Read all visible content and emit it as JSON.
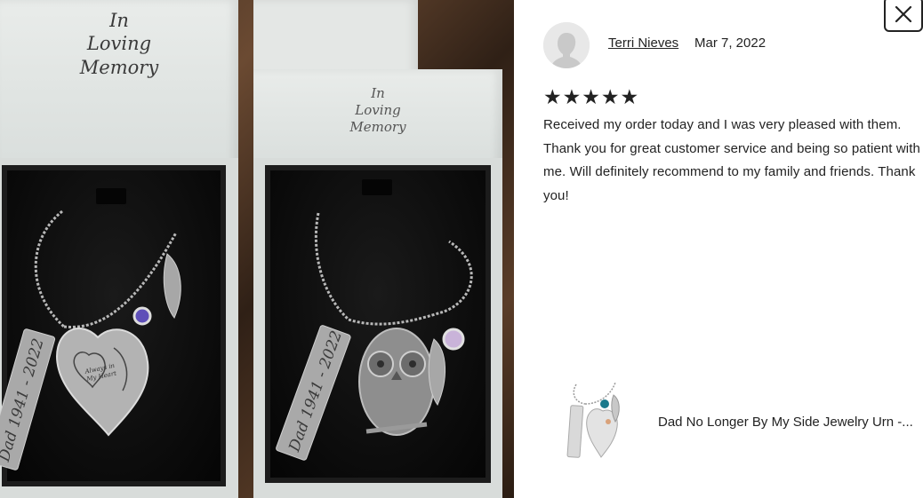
{
  "photo": {
    "left_box_lid_text": [
      "In",
      "Loving",
      "Memory"
    ],
    "right_box_lid_text": [
      "In",
      "Loving",
      "Memory"
    ],
    "left_bar_engraving": "Dad 1941 - 2022",
    "right_bar_engraving": "Dad 1941 - 2022",
    "heart_engraving": [
      "Always in",
      "My Heart"
    ]
  },
  "review": {
    "close_icon": "close-icon",
    "reviewer_name": "Terri Nieves",
    "date": "Mar 7, 2022",
    "rating": 5,
    "stars": [
      "★",
      "★",
      "★",
      "★",
      "★"
    ],
    "text": "Received my order today and I was very pleased with them. Thank you for great customer service and being so patient with me. Will definitely recommend to my family and friends. Thank you!",
    "product_title": "Dad No Longer By My Side Jewelry Urn -..."
  }
}
